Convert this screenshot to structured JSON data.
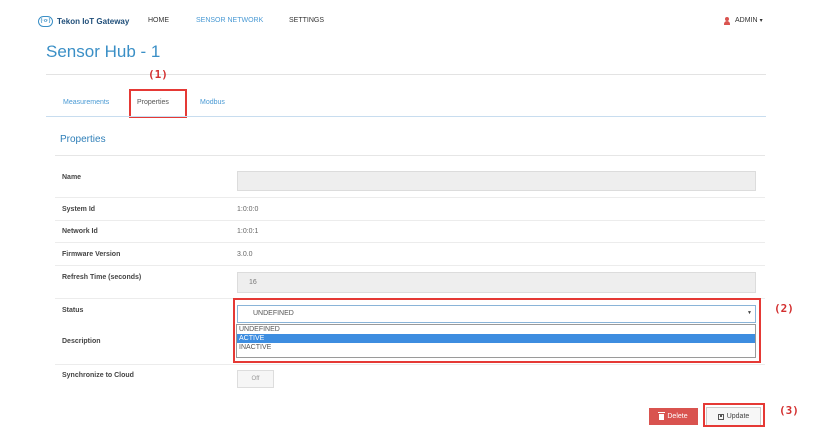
{
  "nav": {
    "brand_text": "Tekon IoT Gateway",
    "brand_logo_text": "(·o·)",
    "items": [
      {
        "label": "HOME",
        "active": false
      },
      {
        "label": "SENSOR NETWORK",
        "active": true
      },
      {
        "label": "SETTINGS",
        "active": false
      }
    ],
    "user_label": "ADMIN",
    "user_caret": "▾"
  },
  "page": {
    "title": "Sensor Hub - 1"
  },
  "tabs": [
    {
      "label": "Measurements",
      "active": false
    },
    {
      "label": "Properties",
      "active": true
    },
    {
      "label": "Modbus",
      "active": false
    }
  ],
  "section": {
    "title": "Properties"
  },
  "properties": {
    "name": {
      "label": "Name",
      "value": ""
    },
    "system_id": {
      "label": "System Id",
      "value": "1:0:0:0"
    },
    "network_id": {
      "label": "Network Id",
      "value": "1:0:0:1"
    },
    "firmware_version": {
      "label": "Firmware Version",
      "value": "3.0.0"
    },
    "refresh_time": {
      "label": "Refresh Time (seconds)",
      "value": "16"
    },
    "status": {
      "label": "Status",
      "selected": "UNDEFINED",
      "arrow": "▼",
      "options": [
        "UNDEFINED",
        "ACTIVE",
        "INACTIVE"
      ],
      "highlighted": "ACTIVE"
    },
    "description": {
      "label": "Description",
      "value": ""
    },
    "synchronize": {
      "label": "Synchronize to Cloud",
      "value": "Off"
    }
  },
  "buttons": {
    "delete": "Delete",
    "update": "Update"
  },
  "annotations": {
    "one": "(1)",
    "two": "(2)",
    "three": "(3)"
  },
  "colors": {
    "accent": "#3a8fc6",
    "danger": "#d9534f",
    "highlight": "#3d8de0",
    "annotation": "#e53935"
  }
}
